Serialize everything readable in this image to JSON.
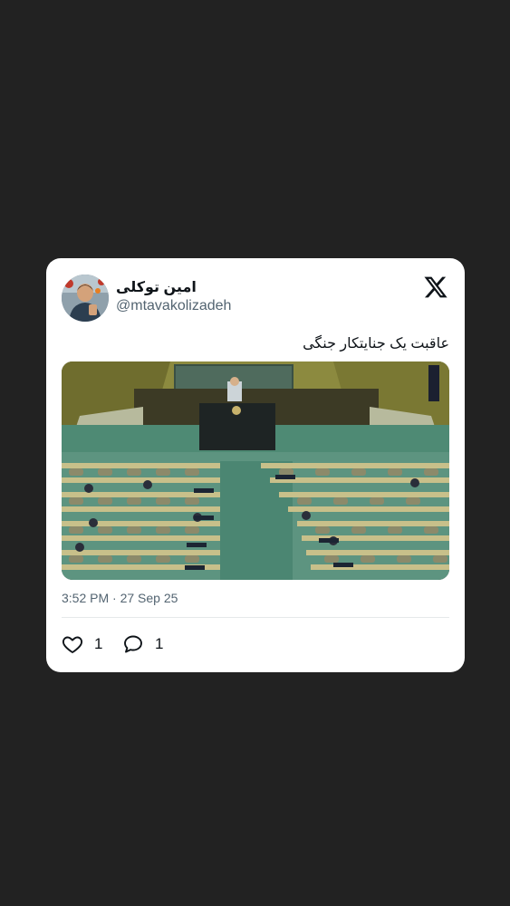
{
  "tweet": {
    "author_name": "امین توکلی",
    "author_handle": "@mtavakolizadeh",
    "text": "عاقبت یک جنایتکار جنگی",
    "timestamp": "3:52 PM · 27 Sep 25",
    "likes": "1",
    "replies": "1"
  },
  "icons": {
    "brand": "x-logo-icon",
    "like": "heart-icon",
    "reply": "speech-bubble-icon"
  },
  "colors": {
    "background": "#222222",
    "card": "#ffffff",
    "text_primary": "#0f1419",
    "text_secondary": "#536471"
  }
}
